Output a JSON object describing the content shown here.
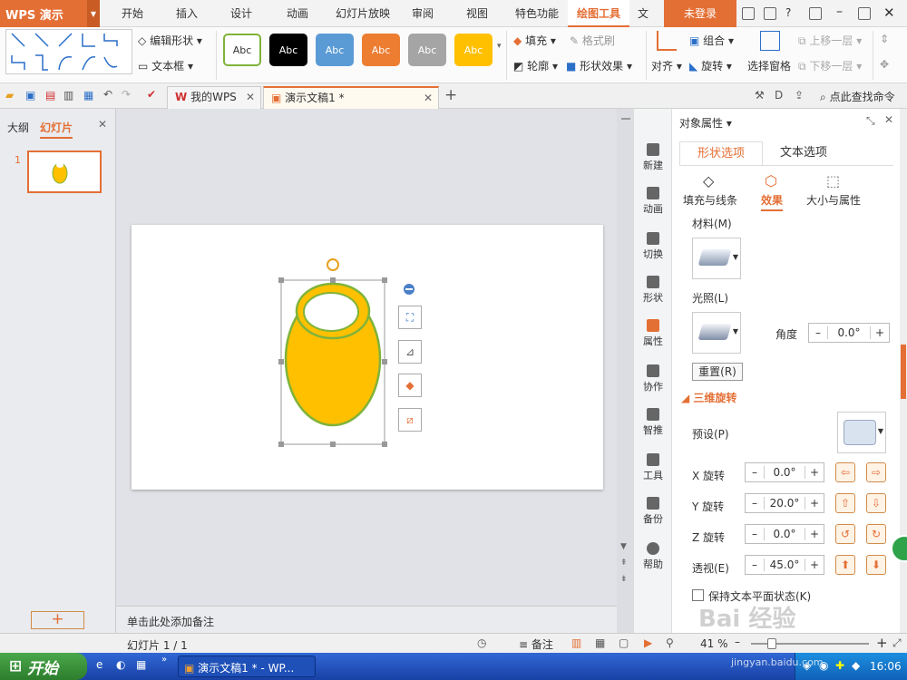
{
  "app": {
    "name": "WPS 演示"
  },
  "menu": {
    "tabs": [
      "开始",
      "插入",
      "设计",
      "动画",
      "幻灯片放映",
      "审阅",
      "视图",
      "特色功能",
      "绘图工具",
      "文"
    ],
    "active": "绘图工具",
    "login": "未登录"
  },
  "ribbon": {
    "edit_shape": "编辑形状",
    "text_box": "文本框",
    "style_label": "Abc",
    "fill": "填充",
    "format_painter": "格式刷",
    "outline": "轮廓",
    "shape_effects": "形状效果",
    "align": "对齐",
    "group": "组合",
    "rotate": "旋转",
    "select_pane": "选择窗格",
    "bring_forward": "上移一层",
    "send_backward": "下移一层"
  },
  "tabs": {
    "my_wps": "我的WPS",
    "doc": "演示文稿1 *",
    "search": "点此查找命令"
  },
  "left": {
    "outline": "大纲",
    "slides": "幻灯片",
    "slide_num": "1"
  },
  "notes": "单击此处添加备注",
  "sidebar": [
    "新建",
    "动画",
    "切换",
    "形状",
    "属性",
    "协作",
    "智推",
    "工具",
    "备份",
    "帮助"
  ],
  "panel": {
    "title": "对象属性",
    "tab_shape": "形状选项",
    "tab_text": "文本选项",
    "sub_fill": "填充与线条",
    "sub_effect": "效果",
    "sub_size": "大小与属性",
    "material": "材料(M)",
    "lighting": "光照(L)",
    "angle": "角度",
    "angle_val": "0.0°",
    "reset": "重置(R)",
    "rot3d": "三维旋转",
    "preset": "预设(P)",
    "x_label": "X 旋转",
    "x_val": "0.0°",
    "y_label": "Y 旋转",
    "y_val": "20.0°",
    "z_label": "Z 旋转",
    "z_val": "0.0°",
    "persp_label": "透视(E)",
    "persp_val": "45.0°",
    "keep_flat": "保持文本平面状态(K)"
  },
  "status": {
    "slide": "幻灯片 1 / 1",
    "notes": "备注",
    "zoom": "41 %"
  },
  "taskbar": {
    "start": "开始",
    "window": "演示文稿1 * - WP...",
    "time": "16:06"
  },
  "colors": {
    "accent": "#e46f35",
    "shape_fill": "#ffc000",
    "shape_outline": "#7fb33a"
  },
  "watermark": {
    "text": "Bai 经验",
    "url": "jingyan.baidu.com"
  }
}
